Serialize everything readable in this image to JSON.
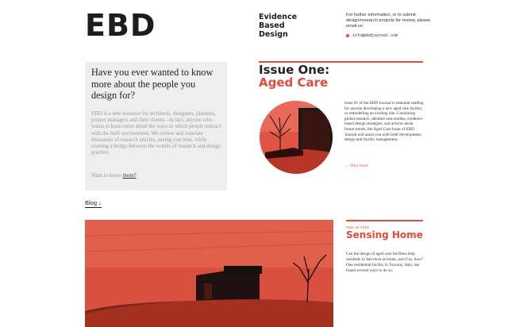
{
  "colors": {
    "accent": "#e8493a",
    "panel": "#eeeeee",
    "text": "#222222"
  },
  "header": {
    "logo": "EBD",
    "tagline": [
      "Evidence",
      "Based",
      "Design"
    ],
    "contact_text": "For further information, or to submit design/research projects for review, please email us:",
    "email": "info@ebdjournal.com"
  },
  "about": {
    "question": "Have you ever wanted to know more about the people you design for?",
    "body": "EBD is a new resource for architects, designers, planners, project managers and their clients—in fact, anyone who wants to learn more about the ways in which people interact with the built environment. We review and translate thousands of research articles, saving you time, while creating a bridge between the worlds of research and design practice.",
    "more_prefix": "Want to know",
    "more_link": "more?"
  },
  "issue": {
    "title": "Issue One:",
    "subtitle": "Aged Care",
    "description": "Issue 01 of the EBD Journal is essential reading for anyone developing a new aged care facility, or remodelling an existing one. Containing global research, detailed case studies, evidence-based design strategies, and articles about future trends, the Aged Care Issue of EBD Journal will assist you with brief development, design and facility management.",
    "view_link": "→ View Issue"
  },
  "blog": {
    "label": "Blog ↓"
  },
  "post": {
    "date": "FEB 16 2018",
    "title": "Sensing Home",
    "text": "Can the design of aged care facilities help residents to feel more at home, and if so, how? One residential facility in Tuscany, Italy, has found several ways to do so."
  }
}
